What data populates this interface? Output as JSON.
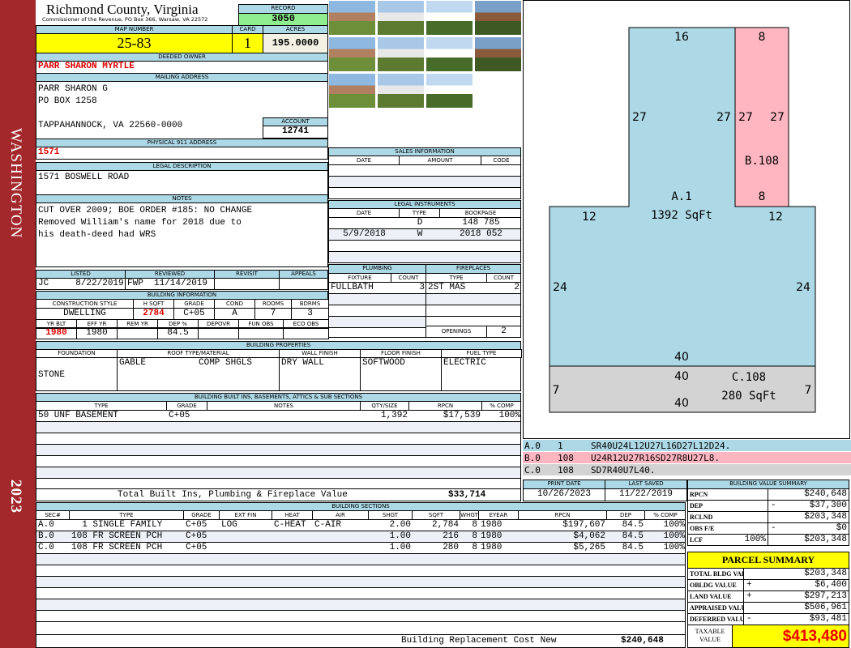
{
  "sidebar": {
    "district": "WASHINGTON",
    "year": "2023"
  },
  "header": {
    "title": "Richmond County, Virginia",
    "subtitle": "Commissioner of the Revenue, PO Box 366, Warsaw, VA 22572",
    "record_label": "RECORD",
    "record": "3050"
  },
  "parcel": {
    "map_label": "MAP NUMBER",
    "map": "25-83",
    "card_label": "CARD",
    "card": "1",
    "acres_label": "ACRES",
    "acres": "195.0000"
  },
  "owner": {
    "label": "DEEDED OWNER",
    "name": "PARR SHARON MYRTLE"
  },
  "mailing": {
    "label": "MAILING ADDRESS",
    "line1": "PARR SHARON G",
    "line2": "PO BOX 1258",
    "line3": "TAPPAHANNOCK, VA 22560-0000",
    "account_label": "ACCOUNT",
    "account": "12741"
  },
  "physical": {
    "label": "PHYSICAL 911 ADDRESS",
    "value": "1571"
  },
  "legal": {
    "label": "LEGAL DESCRIPTION",
    "value": "1571 BOSWELL ROAD"
  },
  "notes": {
    "label": "NOTES",
    "line1": "CUT OVER 2009; BOE ORDER #185: NO CHANGE",
    "line2": "Removed William's name for 2018 due to",
    "line3": "his death-deed had WRS"
  },
  "review": {
    "listed_label": "LISTED",
    "listed": "JC     8/22/2019",
    "reviewed_label": "REVIEWED",
    "reviewed": "FWP  11/14/2019",
    "revisit_label": "REVISIT",
    "revisit": "",
    "appeals_label": "APPEALS",
    "appeals": ""
  },
  "building_info": {
    "label": "BUILDING INFORMATION",
    "h1": [
      "CONSTRUCTION STYLE",
      "H SQFT",
      "GRADE",
      "COND",
      "ROOMS",
      "BDRMS"
    ],
    "v1": [
      "DWELLING",
      "2784",
      "C+05",
      "A",
      "7",
      "3"
    ],
    "h2": [
      "YR BLT",
      "EFF YR",
      "REM YR",
      "DEP %",
      "DEPOVR",
      "FUN OBS",
      "ECO OBS"
    ],
    "v2": [
      "1980",
      "1980",
      "",
      "84.5",
      "",
      "",
      ""
    ]
  },
  "properties": {
    "label": "BUILDING PROPERTIES",
    "headers": [
      "FOUNDATION",
      "ROOF TYPE/MATERIAL",
      "WALL FINISH",
      "FLOOR FINISH",
      "FUEL TYPE"
    ],
    "foundation": "STONE",
    "roof_type": "GABLE",
    "roof_material": "COMP SHGLS",
    "wall": "DRY WALL",
    "floor": "SOFTWOOD",
    "fuel": "ELECTRIC"
  },
  "builtins": {
    "label": "BUILDING BUILT INS, BASEMENTS, ATTICS & SUB SECTIONS",
    "headers": [
      "TYPE",
      "GRADE",
      "NOTES",
      "QTY/SIZE",
      "RPCN",
      "% COMP"
    ],
    "rows": [
      [
        "50 UNF BASEMENT",
        "C+05",
        "",
        "1,392",
        "$17,539",
        "100%"
      ],
      [
        "",
        "",
        "",
        "",
        "",
        ""
      ],
      [
        "",
        "",
        "",
        "",
        "",
        ""
      ],
      [
        "",
        "",
        "",
        "",
        "",
        ""
      ],
      [
        "",
        "",
        "",
        "",
        "",
        ""
      ],
      [
        "",
        "",
        "",
        "",
        "",
        ""
      ],
      [
        "",
        "",
        "",
        "",
        "",
        ""
      ]
    ],
    "total_label": "Total Built Ins, Plumbing & Fireplace Value",
    "total": "$33,714"
  },
  "sections": {
    "label": "BUILDING SECTIONS",
    "headers": [
      "SEC#",
      "TYPE",
      "GRADE",
      "EXT FIN",
      "HEAT",
      "AIR",
      "SHGT",
      "SQFT",
      "WHGT",
      "EYEAR",
      "RPCN",
      "DEP",
      "% COMP"
    ],
    "rows": [
      [
        "A.0",
        "  1 SINGLE FAMILY",
        "C+05",
        "LOG",
        "C-HEAT",
        "C-AIR",
        "2.00",
        "2,784",
        "8",
        "1980",
        "$197,607",
        "84.5",
        "100%"
      ],
      [
        "B.0",
        "108 FR SCREEN PCH",
        "C+05",
        "",
        "",
        "",
        "1.00",
        "216",
        "8",
        "1980",
        "$4,062",
        "84.5",
        "100%"
      ],
      [
        "C.0",
        "108 FR SCREEN PCH",
        "C+05",
        "",
        "",
        "",
        "1.00",
        "280",
        "8",
        "1980",
        "$5,265",
        "84.5",
        "100%"
      ],
      [
        "",
        "",
        "",
        "",
        "",
        "",
        "",
        "",
        "",
        "",
        "",
        "",
        ""
      ],
      [
        "",
        "",
        "",
        "",
        "",
        "",
        "",
        "",
        "",
        "",
        "",
        "",
        ""
      ],
      [
        "",
        "",
        "",
        "",
        "",
        "",
        "",
        "",
        "",
        "",
        "",
        "",
        ""
      ],
      [
        "",
        "",
        "",
        "",
        "",
        "",
        "",
        "",
        "",
        "",
        "",
        "",
        ""
      ],
      [
        "",
        "",
        "",
        "",
        "",
        "",
        "",
        "",
        "",
        "",
        "",
        "",
        ""
      ],
      [
        "",
        "",
        "",
        "",
        "",
        "",
        "",
        "",
        "",
        "",
        "",
        "",
        ""
      ]
    ],
    "total_label": "Building Replacement Cost New",
    "total": "$240,648"
  },
  "sales": {
    "label": "SALES INFORMATION",
    "headers": [
      "DATE",
      "AMOUNT",
      "CODE"
    ],
    "rows": [
      [
        "",
        "",
        ""
      ],
      [
        "",
        "",
        ""
      ],
      [
        "",
        "",
        ""
      ]
    ]
  },
  "instruments": {
    "label": "LEGAL INSTRUMENTS",
    "headers": [
      "DATE",
      "TYPE",
      "BOOKPAGE"
    ],
    "rows": [
      [
        "",
        "D",
        "148 785"
      ],
      [
        "5/9/2018",
        "W",
        "2018 052"
      ],
      [
        "",
        "",
        ""
      ],
      [
        "",
        "",
        ""
      ]
    ]
  },
  "plumbing": {
    "label": "PLUMBING",
    "headers": [
      "FIXTURE",
      "COUNT"
    ],
    "rows": [
      [
        "FULLBATH",
        "3"
      ],
      [
        "",
        ""
      ],
      [
        "",
        ""
      ],
      [
        "",
        ""
      ]
    ]
  },
  "fireplaces": {
    "label": "FIREPLACES",
    "headers": [
      "TYPE",
      "COUNT"
    ],
    "rows": [
      [
        "2ST MAS",
        "2"
      ],
      [
        "",
        ""
      ],
      [
        "",
        ""
      ]
    ],
    "openings_label": "OPENINGS",
    "openings": "2"
  },
  "sketch": {
    "colors": {
      "A": "#add8e6",
      "B": "#ffb6c1",
      "C": "#d3d3d3"
    },
    "labels": {
      "a_top": "16",
      "a_l1": "27",
      "a_r1": "27",
      "a_l2": "12",
      "a_r2": "12",
      "a_l3": "24",
      "a_r3": "24",
      "a_bot": "40",
      "a_name": "A.1",
      "a_area": "1392 SqFt",
      "b_top": "8",
      "b_l": "27",
      "b_r": "27",
      "b_bot": "8",
      "b_name": "B.108",
      "c_top": "40",
      "c_l": "7",
      "c_r": "7",
      "c_bot": "40",
      "c_name": "C.108",
      "c_area": "280 SqFt"
    },
    "codes": [
      [
        "A.0",
        "1",
        "SR40U24L12U27L16D27L12D24."
      ],
      [
        "B.0",
        "108",
        "U24R12U27R16SD27R8U27L8."
      ],
      [
        "C.0",
        "108",
        "SD7R40U7L40."
      ]
    ]
  },
  "dates": {
    "print_label": "PRINT DATE",
    "print": "10/26/2023",
    "saved_label": "LAST SAVED",
    "saved": "11/22/2019"
  },
  "value_summary": {
    "label": "BUILDING VALUE SUMMARY",
    "rows": [
      [
        "RPCN",
        "",
        "",
        "$240,648"
      ],
      [
        "DEP",
        "",
        "-",
        "$37,300"
      ],
      [
        "RCLND",
        "",
        "",
        "$203,348"
      ],
      [
        "OBS F/E",
        "",
        "-",
        "$0"
      ],
      [
        "LCF",
        "100%",
        "",
        "$203,348"
      ]
    ]
  },
  "parcel_summary": {
    "label": "PARCEL SUMMARY",
    "rows": [
      [
        "TOTAL BLDG VALUE",
        "",
        "$203,348"
      ],
      [
        "OBLDG VALUE",
        "+",
        "$6,400"
      ],
      [
        "LAND VALUE",
        "+",
        "$297,213"
      ],
      [
        "APPRAISED VALUE",
        "",
        "$506,961"
      ],
      [
        "DEFERRED VALUE",
        "-",
        "$93,481"
      ]
    ],
    "taxable_label": "TAXABLE VALUE",
    "taxable": "$413,480"
  }
}
